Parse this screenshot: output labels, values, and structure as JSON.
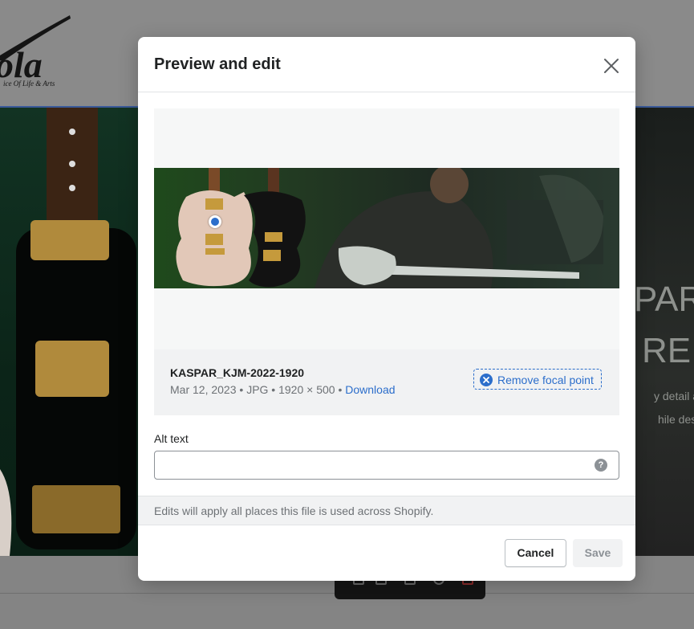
{
  "background": {
    "logo_tagline": "ice Of Life & Arts",
    "heading_line1": "PAR",
    "heading_line2": "RE",
    "body_line1": "y detail an",
    "body_line2": "hile design"
  },
  "modal": {
    "title": "Preview and edit",
    "close_icon": "close-icon",
    "file": {
      "name": "KASPAR_KJM-2022-1920",
      "date": "Mar 12, 2023",
      "type": "JPG",
      "dimensions": "1920 × 500",
      "separator": " • ",
      "download_label": "Download"
    },
    "remove_focal_label": "Remove focal point",
    "alt_text": {
      "label": "Alt text",
      "value": "",
      "placeholder": ""
    },
    "help_icon": "?",
    "notice": "Edits will apply all places this file is used across Shopify.",
    "cancel_label": "Cancel",
    "save_label": "Save"
  },
  "colors": {
    "accent": "#2c6ecb",
    "overlay": "#7d7d7d",
    "title": "#202223",
    "muted": "#6d7175"
  }
}
